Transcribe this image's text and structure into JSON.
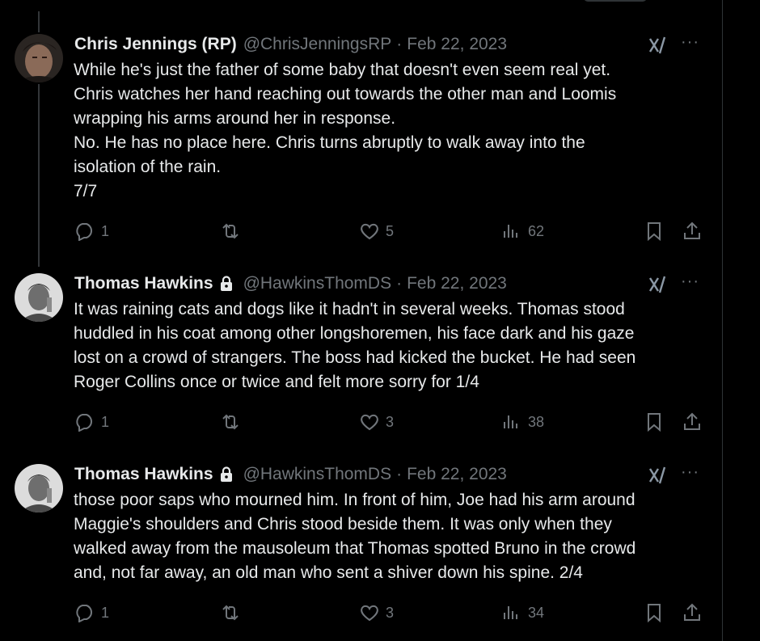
{
  "tweets": [
    {
      "name": "Chris Jennings (RP)",
      "handle": "@ChrisJenningsRP",
      "separator": "·",
      "date": "Feb 22, 2023",
      "locked": false,
      "more": "···",
      "lines": [
        "While he's just the father of some baby that doesn't even seem real yet.",
        "Chris watches her hand reaching out towards the other man and Loomis",
        "wrapping his arms around her in response.",
        "No. He has no place here. Chris turns abruptly to walk away into the",
        "isolation of the rain.",
        "7/7"
      ],
      "replies": "1",
      "retweets": "",
      "likes": "5",
      "views": "62"
    },
    {
      "name": "Thomas Hawkins",
      "handle": "@HawkinsThomDS",
      "separator": "·",
      "date": "Feb 22, 2023",
      "locked": true,
      "more": "···",
      "lines": [
        "It was raining cats and dogs like it hadn't in several weeks. Thomas stood",
        "huddled in his coat among other longshoremen, his face dark and his gaze",
        "lost on a crowd of strangers. The boss had kicked the bucket. He had seen",
        "Roger Collins once or twice and felt more sorry for 1/4"
      ],
      "replies": "1",
      "retweets": "",
      "likes": "3",
      "views": "38"
    },
    {
      "name": "Thomas Hawkins",
      "handle": "@HawkinsThomDS",
      "separator": "·",
      "date": "Feb 22, 2023",
      "locked": true,
      "more": "···",
      "lines": [
        "those poor saps who mourned him. In front of him, Joe had his arm around",
        "Maggie's shoulders and Chris stood beside them. It was only when they",
        "walked away from the mausoleum that Thomas spotted Bruno in the crowd",
        "and, not far away, an old man who sent a shiver down his spine. 2/4"
      ],
      "replies": "1",
      "retweets": "",
      "likes": "3",
      "views": "34"
    }
  ],
  "icons": {
    "reply": "speech-bubble-icon",
    "retweet": "retweet-arrows-icon",
    "like": "heart-icon",
    "views": "bar-chart-icon",
    "bookmark": "bookmark-icon",
    "share": "share-upload-icon",
    "grok": "grok-slash-icon",
    "lock": "lock-icon"
  },
  "colors": {
    "background": "#000000",
    "text": "#e7e9ea",
    "muted": "#71767b",
    "divider": "#2f3336"
  }
}
